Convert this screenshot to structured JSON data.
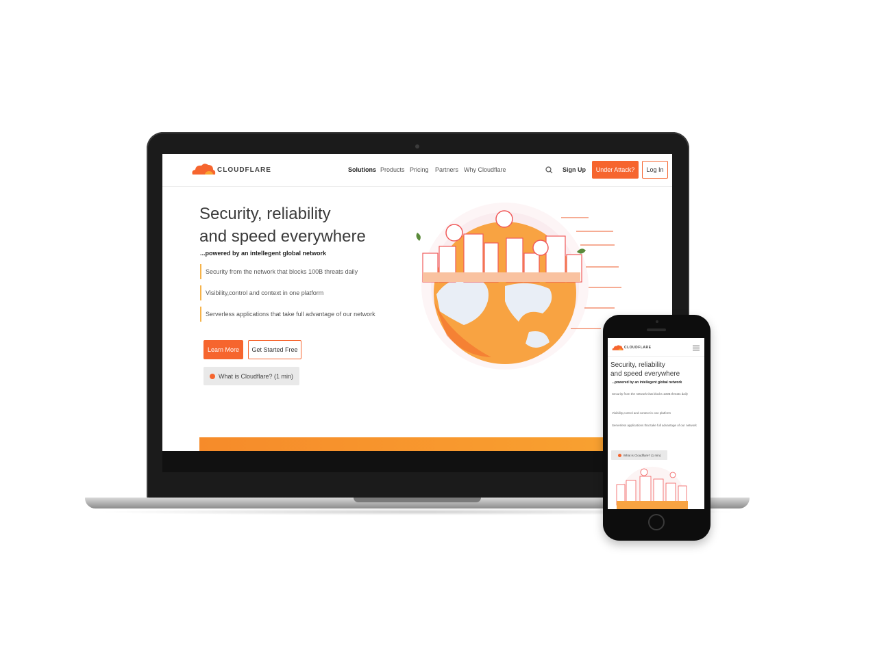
{
  "desktop": {
    "brand": "CLOUDFLARE",
    "nav": {
      "items": [
        "Solutions",
        "Products",
        "Pricing",
        "Partners",
        "Why Cloudflare"
      ],
      "sign_up": "Sign Up",
      "under_attack": "Under Attack?",
      "log_in": "Log In"
    },
    "hero": {
      "title_line1": "Security, reliability",
      "title_line2": "and speed everywhere",
      "subtitle": "...powered by an intellegent global network",
      "bullets": [
        "Security from the network that blocks 100B threats daily",
        "Visibility,control and context in one platform",
        "Serverless applications that take full advantage of our network"
      ],
      "learn_more": "Learn More",
      "get_started": "Get Started Free",
      "video": "What is Cloudflare? (1 min)"
    }
  },
  "mobile": {
    "brand": "CLOUDFLARE",
    "title_line1": "Security, reliability",
    "title_line2": "and speed everywhere",
    "subtitle": "...powered by an intellegent global network",
    "bullets": [
      "Security from the network that blocks 100B threats daily",
      "Visibility,control and context in one platform",
      "Serverless applications that take full advantage of our network"
    ],
    "video": "What is Cloudflare? (1 min)"
  },
  "colors": {
    "accent": "#f6652e",
    "accent_light": "#f9a431"
  },
  "icons": [
    "search-icon",
    "cloud-logo-icon",
    "hamburger-menu-icon",
    "play-icon"
  ]
}
